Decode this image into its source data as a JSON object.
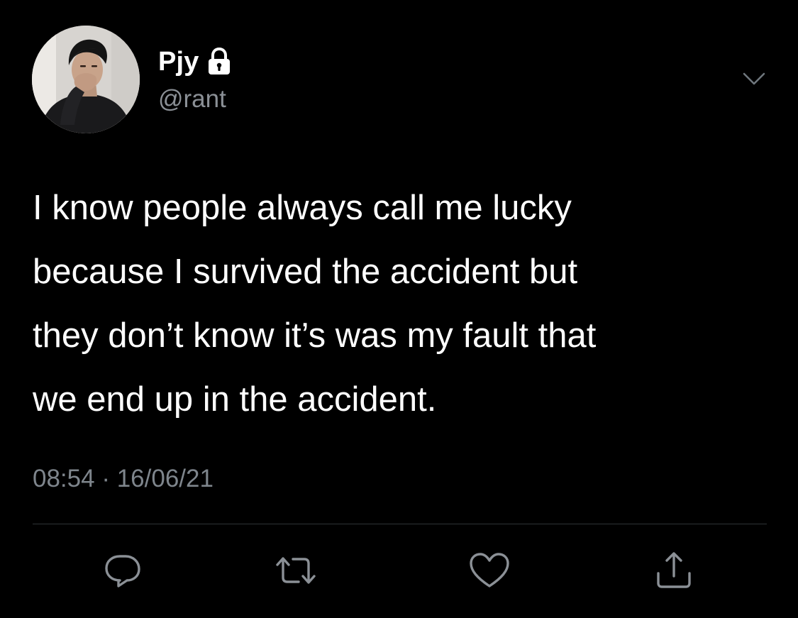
{
  "user": {
    "display_name": "Pjy",
    "handle": "@rant",
    "protected_icon": "lock-icon",
    "avatar_icon": "avatar"
  },
  "tweet": {
    "text": "I know people always call me lucky\nbecause I survived the accident but\nthey don’t know it’s was my fault that\nwe end up in the accident.",
    "time": "08:54",
    "separator": "·",
    "date": "16/06/21"
  },
  "actions": [
    {
      "name": "reply",
      "icon": "reply-icon"
    },
    {
      "name": "retweet",
      "icon": "retweet-icon"
    },
    {
      "name": "like",
      "icon": "heart-icon"
    },
    {
      "name": "share",
      "icon": "share-icon"
    }
  ],
  "menu": {
    "icon": "chevron-down-icon"
  },
  "colors": {
    "background": "#000000",
    "text": "#ffffff",
    "secondary": "#8b9096",
    "icon": "#8b9096",
    "divider": "#2f3336"
  }
}
